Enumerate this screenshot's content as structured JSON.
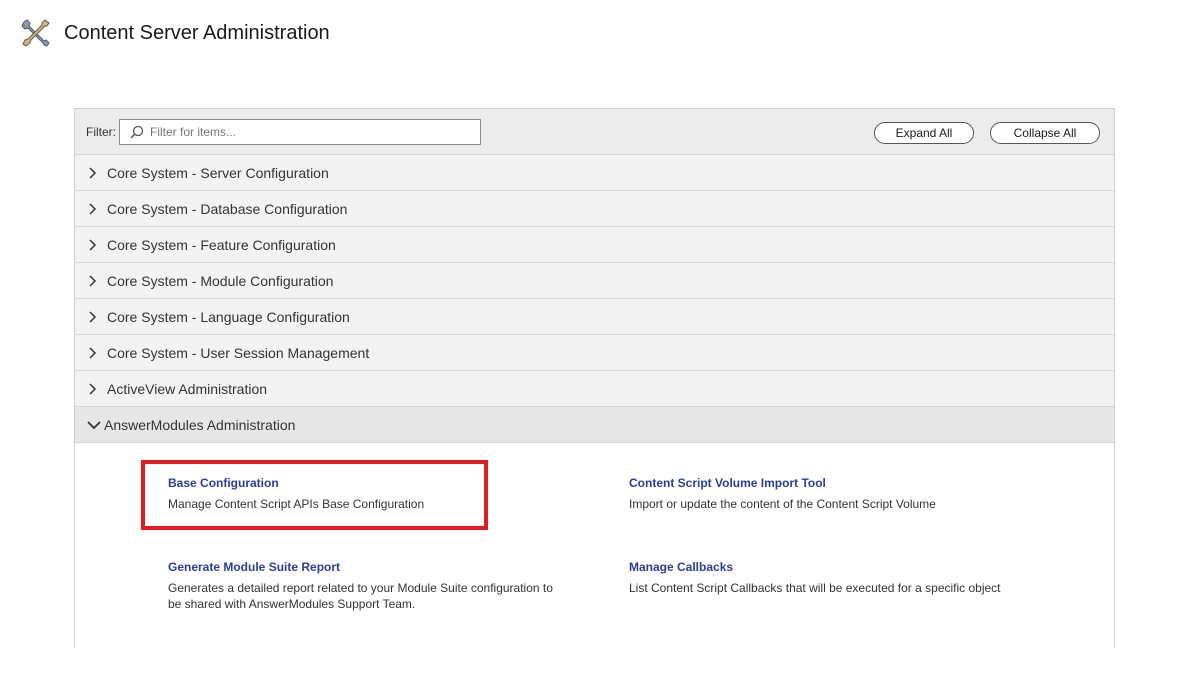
{
  "header": {
    "title": "Content Server Administration",
    "icon": "tools-icon"
  },
  "filter": {
    "label": "Filter:",
    "placeholder": "Filter for items...",
    "value": ""
  },
  "toolbar": {
    "expand_all": "Expand All",
    "collapse_all": "Collapse All"
  },
  "sections": [
    {
      "label": "Core System - Server Configuration",
      "expanded": false
    },
    {
      "label": "Core System - Database Configuration",
      "expanded": false
    },
    {
      "label": "Core System - Feature Configuration",
      "expanded": false
    },
    {
      "label": "Core System - Module Configuration",
      "expanded": false
    },
    {
      "label": "Core System - Language Configuration",
      "expanded": false
    },
    {
      "label": "Core System - User Session Management",
      "expanded": false
    },
    {
      "label": "ActiveView Administration",
      "expanded": false
    },
    {
      "label": "AnswerModules Administration",
      "expanded": true
    }
  ],
  "answermodules_items": [
    {
      "title": "Base Configuration",
      "description": "Manage Content Script APIs Base Configuration",
      "highlighted": true
    },
    {
      "title": "Content Script Volume Import Tool",
      "description": "Import or update the content of the Content Script Volume"
    },
    {
      "title": "Generate Module Suite Report",
      "description": "Generates a detailed report related to your Module Suite configuration to be shared with AnswerModules Support Team."
    },
    {
      "title": "Manage Callbacks",
      "description": "List Content Script Callbacks that will be executed for a specific object"
    }
  ],
  "colors": {
    "link": "#2a3f8f",
    "highlight": "#e21b22",
    "row_bg": "#f2f2f2",
    "filter_bar_bg": "#ececec"
  }
}
